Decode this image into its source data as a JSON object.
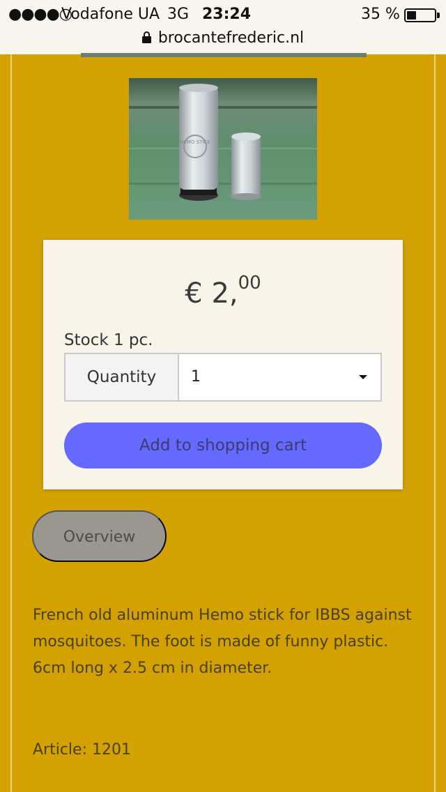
{
  "status_bar": {
    "signal": "●●●●○",
    "carrier": "Vodafone UA",
    "network": "3G",
    "time": "23:24",
    "battery_percent": "35 %",
    "battery_level": 0.35,
    "url": "brocantefrederic.nl",
    "lock_icon": "lock-icon"
  },
  "product": {
    "image_description": "two aluminum Hemo stick tubes on green wood",
    "image_text": "HEMO STICK",
    "price_main": "€ 2,",
    "price_cents": "00",
    "stock": "Stock 1 pc.",
    "quantity_label": "Quantity",
    "quantity_value": "1",
    "add_to_cart": "Add to shopping cart",
    "overview": "Overview",
    "description": "French old aluminum Hemo stick for IBBS against mosquitoes. The foot is made of funny plastic. 6cm long x 2.5 cm in diameter.",
    "article": "Article: 1201"
  },
  "colors": {
    "page_background": "#d3a100",
    "card_background": "#f8f4ea",
    "cart_button": "#6669ff",
    "overview_button": "#9a9690"
  }
}
